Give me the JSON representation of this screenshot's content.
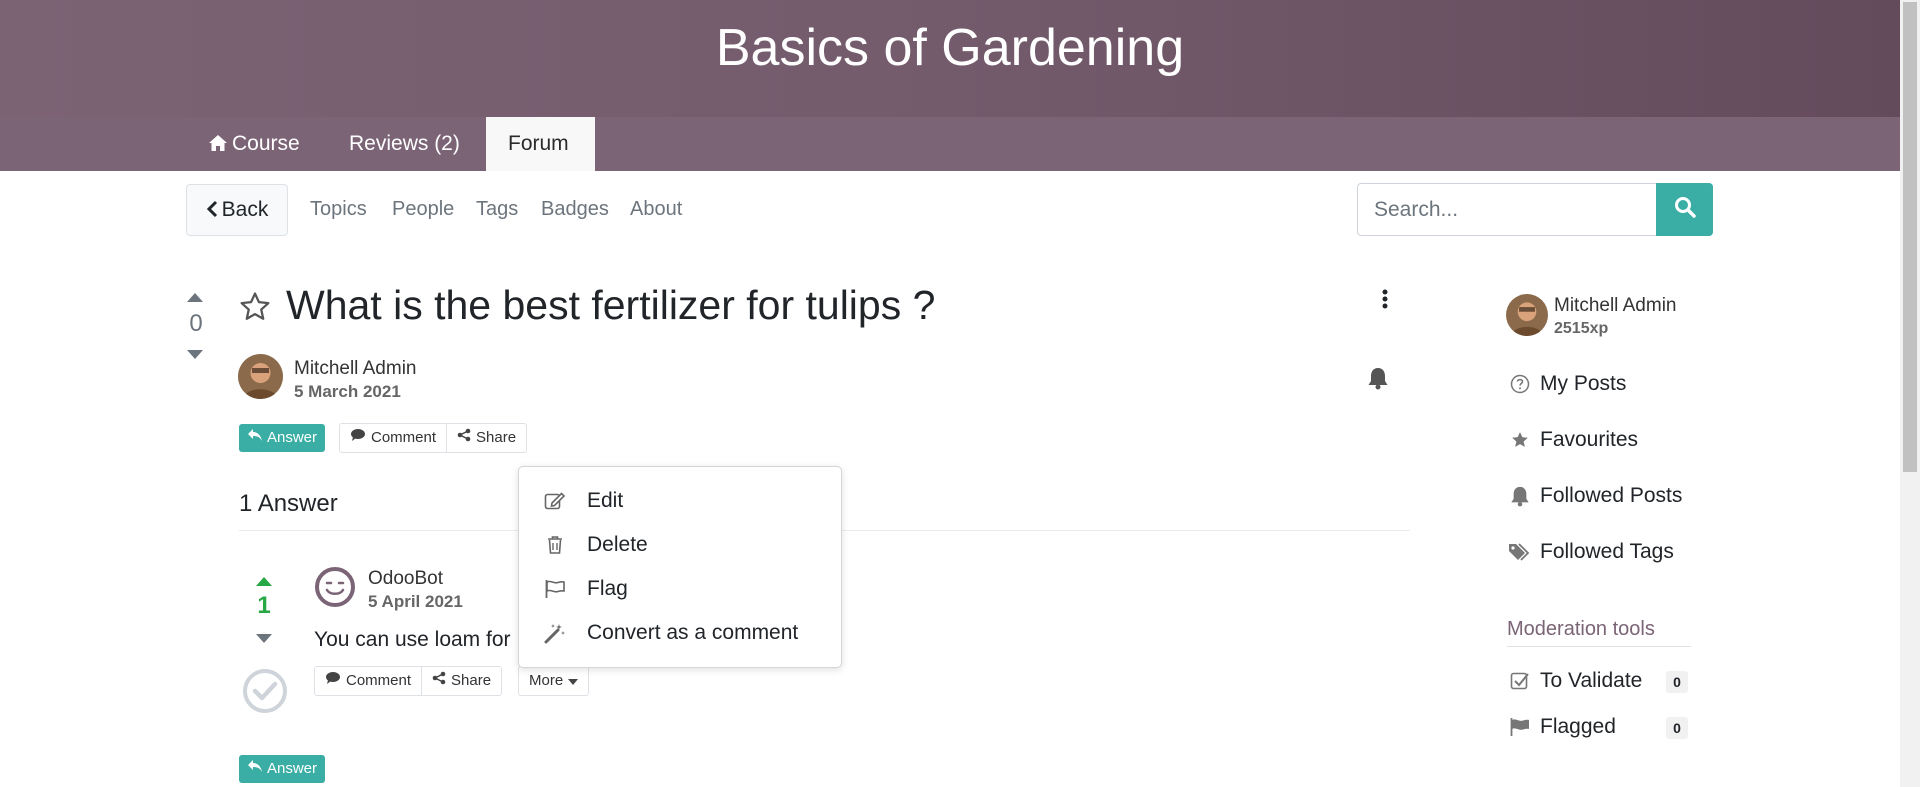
{
  "banner": {
    "title": "Basics of Gardening"
  },
  "tabs": [
    {
      "label": "Course"
    },
    {
      "label": "Reviews (2)"
    },
    {
      "label": "Forum"
    }
  ],
  "subnav": {
    "back_label": "Back",
    "links": [
      "Topics",
      "People",
      "Tags",
      "Badges",
      "About"
    ],
    "search_placeholder": "Search..."
  },
  "question": {
    "votes": "0",
    "title": "What is the best fertilizer for tulips ?",
    "author": "Mitchell Admin",
    "date": "5 March 2021",
    "answer_label": "Answer",
    "comment_label": "Comment",
    "share_label": "Share"
  },
  "answers_header": "1 Answer",
  "answer": {
    "votes": "1",
    "author": "OdooBot",
    "date": "5 April 2021",
    "text": "You can use loam for",
    "comment_label": "Comment",
    "share_label": "Share",
    "more_label": "More"
  },
  "bottom_answer_label": "Answer",
  "dropdown": {
    "items": [
      {
        "label": "Edit",
        "icon": "edit-icon"
      },
      {
        "label": "Delete",
        "icon": "trash-icon"
      },
      {
        "label": "Flag",
        "icon": "flag-icon"
      },
      {
        "label": "Convert as a comment",
        "icon": "magic-wand-icon"
      }
    ]
  },
  "sidebar": {
    "user_name": "Mitchell Admin",
    "xp": "2515xp",
    "links": [
      {
        "label": "My Posts",
        "icon": "question-circle-icon"
      },
      {
        "label": "Favourites",
        "icon": "star-icon"
      },
      {
        "label": "Followed Posts",
        "icon": "bell-icon"
      },
      {
        "label": "Followed Tags",
        "icon": "tags-icon"
      }
    ],
    "moderation_title": "Moderation tools",
    "moderation": [
      {
        "label": "To Validate",
        "count": "0",
        "icon": "check-square-icon"
      },
      {
        "label": "Flagged",
        "count": "0",
        "icon": "flag-icon"
      }
    ]
  },
  "colors": {
    "accent": "#3aada5",
    "banner": "#735b6c",
    "positive_vote": "#28a745"
  }
}
